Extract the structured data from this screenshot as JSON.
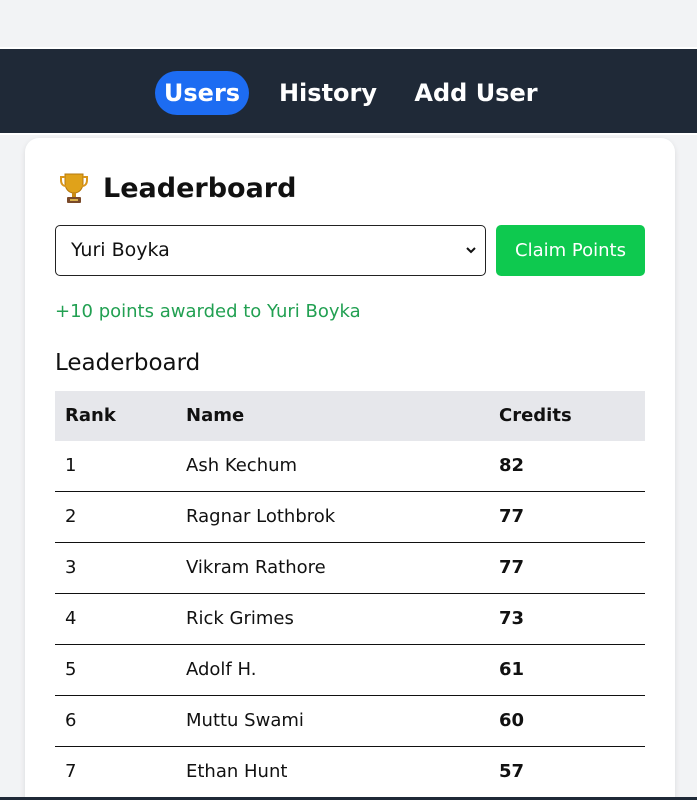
{
  "nav": {
    "users": "Users",
    "history": "History",
    "add_user": "Add User",
    "active": "Users",
    "accent": "#1d6cf2",
    "bar_color": "#1f2937"
  },
  "leaderboard_card": {
    "title": "Leaderboard",
    "title_icon": "trophy-icon",
    "selected_user": "Yuri Boyka",
    "claim_label": "Claim Points",
    "claim_color": "#0ec94f",
    "message": "+10 points awarded to Yuri Boyka",
    "message_color": "#22a052",
    "section_title": "Leaderboard"
  },
  "table": {
    "headers": {
      "rank": "Rank",
      "name": "Name",
      "credits": "Credits"
    },
    "rows": [
      {
        "rank": "1",
        "name": "Ash Kechum",
        "credits": "82"
      },
      {
        "rank": "2",
        "name": "Ragnar Lothbrok",
        "credits": "77"
      },
      {
        "rank": "3",
        "name": "Vikram Rathore",
        "credits": "77"
      },
      {
        "rank": "4",
        "name": "Rick Grimes",
        "credits": "73"
      },
      {
        "rank": "5",
        "name": "Adolf H.",
        "credits": "61"
      },
      {
        "rank": "6",
        "name": "Muttu Swami",
        "credits": "60"
      },
      {
        "rank": "7",
        "name": "Ethan Hunt",
        "credits": "57"
      }
    ]
  }
}
